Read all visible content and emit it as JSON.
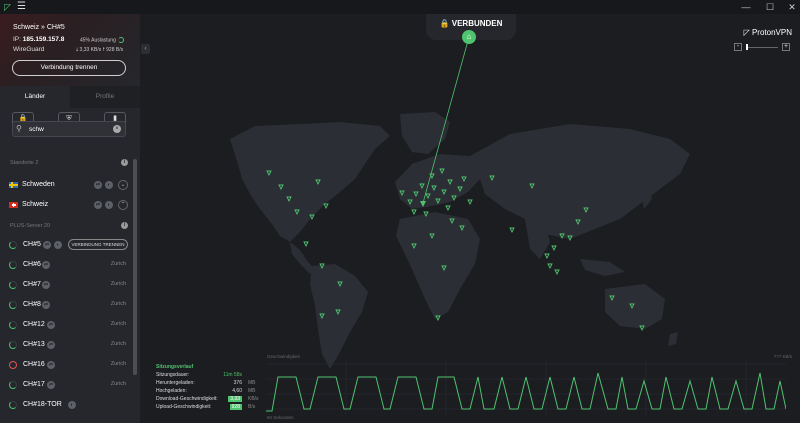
{
  "window": {
    "menu_icon": "hamburger-icon",
    "minimize": "—",
    "maximize": "☐",
    "close": "✕"
  },
  "connection": {
    "server": "Schweiz » CH#5",
    "ip_label": "IP:",
    "ip": "185.159.157.8",
    "load": "45% Auslastung",
    "load_percent": 45,
    "protocol": "WireGuard",
    "speed": "🠗 3,33 KB/s 🠕 928 B/s",
    "disconnect_label": "Verbindung trennen"
  },
  "tabs": [
    {
      "label": "Länder",
      "active": true
    },
    {
      "label": "Profile",
      "active": false
    }
  ],
  "filters": [
    {
      "icon": "lock-icon",
      "glyph": "🔒"
    },
    {
      "icon": "shield-icon",
      "glyph": "⛨"
    },
    {
      "icon": "card-icon",
      "glyph": "▮"
    }
  ],
  "search": {
    "value": "schw",
    "icon": "search-icon",
    "clear_icon": "clear-icon"
  },
  "sections": {
    "standard": "Standorte 2",
    "plus": "PLUS-Server 20"
  },
  "countries": [
    {
      "name": "Schweden",
      "flag": "se",
      "expand": "⌄"
    },
    {
      "name": "Schweiz",
      "flag": "ch",
      "expand": "⌃"
    }
  ],
  "servers": [
    {
      "name": "CH#5",
      "action": "VERBINDUNG TRENNEN",
      "connected": true,
      "ring": "green"
    },
    {
      "name": "CH#6",
      "action": "Zurich",
      "connected": false,
      "ring": "green"
    },
    {
      "name": "CH#7",
      "action": "Zurich",
      "connected": false,
      "ring": "green"
    },
    {
      "name": "CH#8",
      "action": "Zurich",
      "connected": false,
      "ring": "green"
    },
    {
      "name": "CH#12",
      "action": "Zurich",
      "connected": false,
      "ring": "green"
    },
    {
      "name": "CH#13",
      "action": "Zurich",
      "connected": false,
      "ring": "green"
    },
    {
      "name": "CH#16",
      "action": "Zurich",
      "connected": false,
      "ring": "red"
    },
    {
      "name": "CH#17",
      "action": "Zurich",
      "connected": false,
      "ring": "green"
    },
    {
      "name": "CH#18-TOR",
      "action": "",
      "connected": false,
      "ring": "green"
    }
  ],
  "status": {
    "label": "🔒 VERBUNDEN",
    "home_icon": "home-icon"
  },
  "brand": "ProtonVPN",
  "zoom": {
    "minus": "-",
    "plus": "+"
  },
  "stats": {
    "title": "Sitzungsverlauf",
    "rows": [
      {
        "label": "Sitzungsdauer:",
        "value": "11m 58s",
        "unit": "",
        "highlight": false
      },
      {
        "label": "Heruntergeladen:",
        "value": "376",
        "unit": "MB",
        "highlight": false
      },
      {
        "label": "Hochgeladen:",
        "value": "4,60",
        "unit": "MB",
        "highlight": false
      },
      {
        "label": "Download-Geschwindigkeit:",
        "value": "3,33",
        "unit": "KB/s",
        "highlight": true
      },
      {
        "label": "Upload-Geschwindigkeit:",
        "value": "928",
        "unit": "B/s",
        "highlight": true
      }
    ],
    "graph_top_left": "Geschwindigkeit",
    "graph_top_right": "??? KB/s",
    "graph_bottom_left": "60 Sekunden"
  },
  "colors": {
    "accent": "#4fc36e",
    "background": "#1c1d21",
    "sidebar": "#25272c",
    "land": "#2b2e34",
    "danger": "#e05555"
  }
}
